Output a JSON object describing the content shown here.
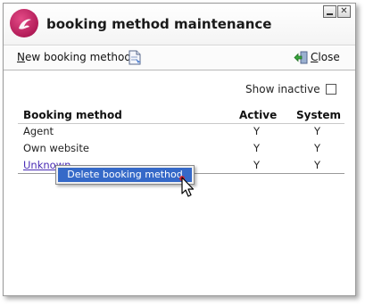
{
  "window": {
    "title": "booking method maintenance",
    "logo_color": "#c0246a"
  },
  "toolbar": {
    "new_label_underlined": "N",
    "new_label_rest": "ew booking method",
    "close_label_underlined": "C",
    "close_label_rest": "lose"
  },
  "filter": {
    "show_inactive_label": "Show inactive",
    "show_inactive_checked": false
  },
  "table": {
    "columns": [
      "Booking method",
      "Active",
      "System"
    ],
    "rows": [
      [
        "Agent",
        "Y",
        "Y"
      ],
      [
        "Own website",
        "Y",
        "Y"
      ],
      [
        "Unknown",
        "Y",
        "Y"
      ]
    ]
  },
  "context_menu": {
    "items": [
      "Delete booking method"
    ],
    "highlight_color": "#3569c8"
  }
}
